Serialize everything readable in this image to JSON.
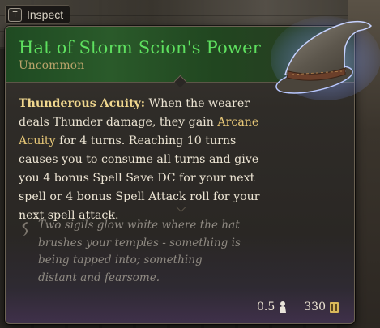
{
  "hint": {
    "key": "T",
    "label": "Inspect"
  },
  "item": {
    "name": "Hat of Storm Scion's Power",
    "rarity": "Uncommon",
    "icon": "wizard-hat-icon"
  },
  "description": {
    "ability_name": "Thunderous Acuity:",
    "text_before_keyword": "When the wearer deals Thunder damage, they gain",
    "keyword": "Arcane Acuity",
    "text_after_keyword": "for 4 turns. Reaching 10 turns causes you to consume all turns and give you 4 bonus Spell Save DC for your next spell or 4 bonus Spell Attack roll for your next spell attack."
  },
  "lore": {
    "icon": "quote-icon",
    "text": "Two sigils glow white where the hat brushes your temples - something is being tapped into; something distant and fearsome."
  },
  "footer": {
    "weight": "0.5",
    "weight_icon": "weight-icon",
    "value": "330",
    "value_icon": "gold-icon"
  },
  "colors": {
    "rarity_name": "#5ee05f",
    "rarity_label": "#b9a36a",
    "ability_name": "#f0d78e",
    "keyword": "#e8c878",
    "lore_text": "#8f8a82",
    "header_bg": "#2a5a2a"
  }
}
